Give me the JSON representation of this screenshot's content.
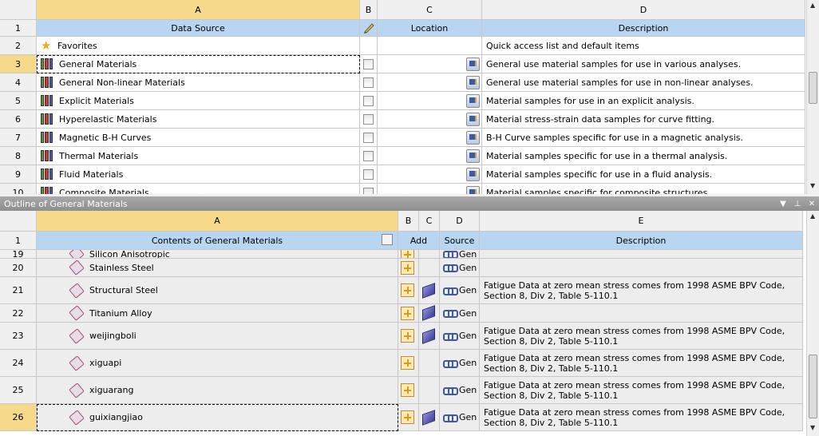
{
  "top_table": {
    "col_letters": [
      "A",
      "B",
      "C",
      "D"
    ],
    "headers": {
      "data_source": "Data Source",
      "location": "Location",
      "description": "Description"
    },
    "header_row_num": "1",
    "rows": [
      {
        "num": "2",
        "name": "Favorites",
        "icon": "star-icon",
        "has_checkbox": false,
        "description": "Quick access list and default items"
      },
      {
        "num": "3",
        "name": "General Materials",
        "icon": "library-icon",
        "has_checkbox": true,
        "description": "General use material samples for use in various analyses."
      },
      {
        "num": "4",
        "name": "General Non-linear Materials",
        "icon": "library-icon",
        "has_checkbox": true,
        "description": "General use material samples for use in non-linear analyses."
      },
      {
        "num": "5",
        "name": "Explicit Materials",
        "icon": "library-icon",
        "has_checkbox": true,
        "description": "Material samples for use in an explicit analysis."
      },
      {
        "num": "6",
        "name": "Hyperelastic Materials",
        "icon": "library-icon",
        "has_checkbox": true,
        "description": "Material stress-strain data samples for curve fitting."
      },
      {
        "num": "7",
        "name": "Magnetic B-H Curves",
        "icon": "library-icon",
        "has_checkbox": true,
        "description": "B-H Curve samples specific for use in a magnetic analysis."
      },
      {
        "num": "8",
        "name": "Thermal Materials",
        "icon": "library-icon",
        "has_checkbox": true,
        "description": "Material samples specific for use in a thermal analysis."
      },
      {
        "num": "9",
        "name": "Fluid Materials",
        "icon": "library-icon",
        "has_checkbox": true,
        "description": "Material samples specific for use in a fluid analysis."
      },
      {
        "num": "10",
        "name": "Composite Materials",
        "icon": "library-icon",
        "has_checkbox": true,
        "description": "Material samples specific for composite structures."
      }
    ]
  },
  "outline": {
    "title": "Outline of General Materials",
    "col_letters": [
      "A",
      "B",
      "C",
      "D",
      "E"
    ],
    "headers": {
      "contents": "Contents of General Materials",
      "add": "Add",
      "source": "Source",
      "description": "Description"
    },
    "header_row_num": "1",
    "rows": [
      {
        "num": "19",
        "name": "Silicon Anisotropic",
        "has_book": false,
        "source": "Gen",
        "description": ""
      },
      {
        "num": "20",
        "name": "Stainless Steel",
        "has_book": false,
        "source": "Gen",
        "description": ""
      },
      {
        "num": "21",
        "name": "Structural Steel",
        "has_book": true,
        "source": "Gen",
        "description": "Fatigue Data at zero mean stress comes from 1998 ASME BPV Code, Section 8, Div 2, Table 5-110.1"
      },
      {
        "num": "22",
        "name": "Titanium Alloy",
        "has_book": true,
        "source": "Gen",
        "description": ""
      },
      {
        "num": "23",
        "name": "weijingboli",
        "has_book": true,
        "source": "Gen",
        "description": "Fatigue Data at zero mean stress comes from 1998 ASME BPV Code, Section 8, Div 2, Table 5-110.1"
      },
      {
        "num": "24",
        "name": "xiguapi",
        "has_book": false,
        "source": "Gen",
        "description": "Fatigue Data at zero mean stress comes from 1998 ASME BPV Code, Section 8, Div 2, Table 5-110.1"
      },
      {
        "num": "25",
        "name": "xiguarang",
        "has_book": false,
        "source": "Gen",
        "description": "Fatigue Data at zero mean stress comes from 1998 ASME BPV Code, Section 8, Div 2, Table 5-110.1"
      },
      {
        "num": "26",
        "name": "guixiangjiao",
        "has_book": true,
        "source": "Gen",
        "description": "Fatigue Data at zero mean stress comes from 1998 ASME BPV Code, Section 8, Div 2, Table 5-110.1"
      }
    ]
  },
  "colors": {
    "selected_header": "#f6d98a",
    "header_blue": "#b8d6f2",
    "title_bar": "#999999"
  }
}
